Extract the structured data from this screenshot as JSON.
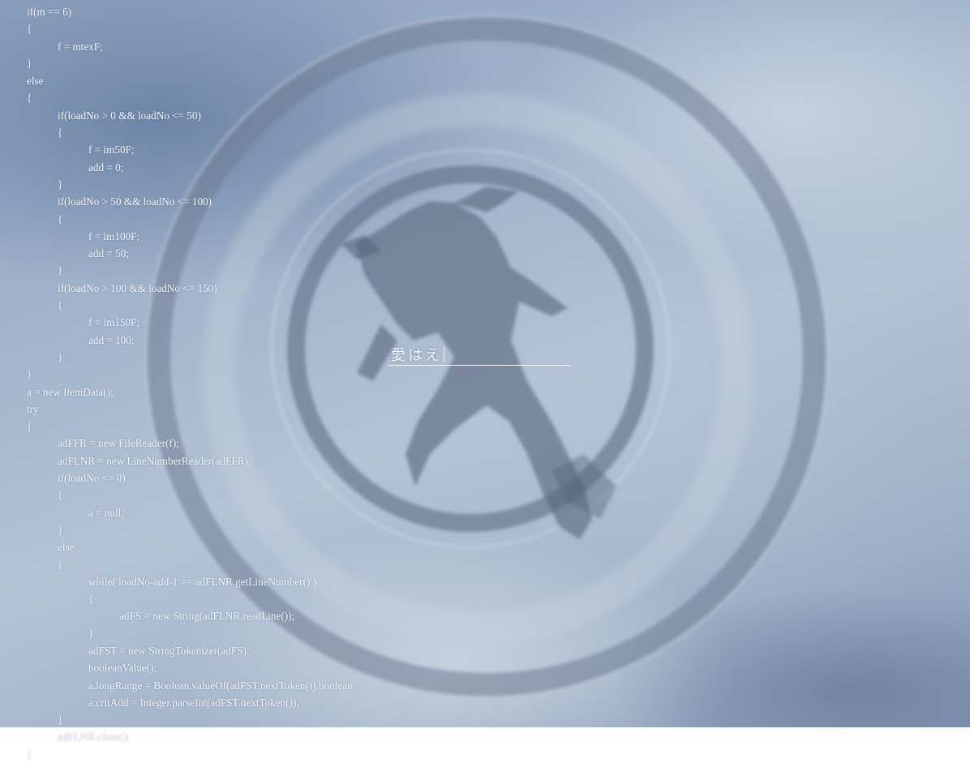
{
  "code_lines": [
    {
      "indent": 0,
      "text": "if(m == 6)"
    },
    {
      "indent": 0,
      "text": "{"
    },
    {
      "indent": 1,
      "text": "f = mtexF;"
    },
    {
      "indent": 0,
      "text": "}"
    },
    {
      "indent": 0,
      "text": "else"
    },
    {
      "indent": 0,
      "text": "{"
    },
    {
      "indent": 1,
      "text": "if(loadNo > 0 && loadNo <= 50)"
    },
    {
      "indent": 1,
      "text": "{"
    },
    {
      "indent": 2,
      "text": "f = im50F;"
    },
    {
      "indent": 2,
      "text": "add = 0;"
    },
    {
      "indent": 1,
      "text": "}"
    },
    {
      "indent": 1,
      "text": "if(loadNo > 50 && loadNo <= 100)"
    },
    {
      "indent": 1,
      "text": "{"
    },
    {
      "indent": 2,
      "text": "f = im100F;"
    },
    {
      "indent": 2,
      "text": "add = 50;"
    },
    {
      "indent": 1,
      "text": "}"
    },
    {
      "indent": 1,
      "text": "if(loadNo > 100 && loadNo <= 150)"
    },
    {
      "indent": 1,
      "text": "{"
    },
    {
      "indent": 2,
      "text": "f = im150F;"
    },
    {
      "indent": 2,
      "text": "add = 100;"
    },
    {
      "indent": 1,
      "text": "}"
    },
    {
      "indent": 0,
      "text": "}"
    },
    {
      "indent": 0,
      "text": "a = new ItemData();"
    },
    {
      "indent": 0,
      "text": "try"
    },
    {
      "indent": 0,
      "text": "{"
    },
    {
      "indent": 1,
      "text": "adFFR = new FileReader(f);"
    },
    {
      "indent": 1,
      "text": "adFLNR = new LineNumberReader(adFFR);"
    },
    {
      "indent": 1,
      "text": "if(loadNo <= 0)"
    },
    {
      "indent": 1,
      "text": "{"
    },
    {
      "indent": 2,
      "text": "a = null;"
    },
    {
      "indent": 1,
      "text": "}"
    },
    {
      "indent": 1,
      "text": "else"
    },
    {
      "indent": 1,
      "text": "{"
    },
    {
      "indent": 2,
      "text": "while( loadNo-add-1 >= adFLNR.getLineNumber() )"
    },
    {
      "indent": 2,
      "text": "{"
    },
    {
      "indent": 3,
      "text": "adFS = new String(adFLNR.readLine());"
    },
    {
      "indent": 2,
      "text": "}"
    },
    {
      "indent": 2,
      "text": "adFST = new StringTokenizer(adFS);"
    },
    {
      "indent": 2,
      "text": "booleanValue();"
    },
    {
      "indent": 2,
      "text": "a.longRange = Boolean.valueOf(adFST.nextToken()).boolean"
    },
    {
      "indent": 2,
      "text": "a.critAdd = Integer.parseInt(adFST.nextToken());"
    },
    {
      "indent": 1,
      "text": "}"
    },
    {
      "indent": 1,
      "text": "adFLNR.close();"
    },
    {
      "indent": 0,
      "text": "}"
    }
  ],
  "name_input": {
    "value": "愛はえ"
  },
  "colors": {
    "text": "#f4f7fb",
    "ring": "#5f6e85",
    "figure": "#56657d"
  },
  "icons": {
    "emblem": "ring-emblem-icon"
  }
}
